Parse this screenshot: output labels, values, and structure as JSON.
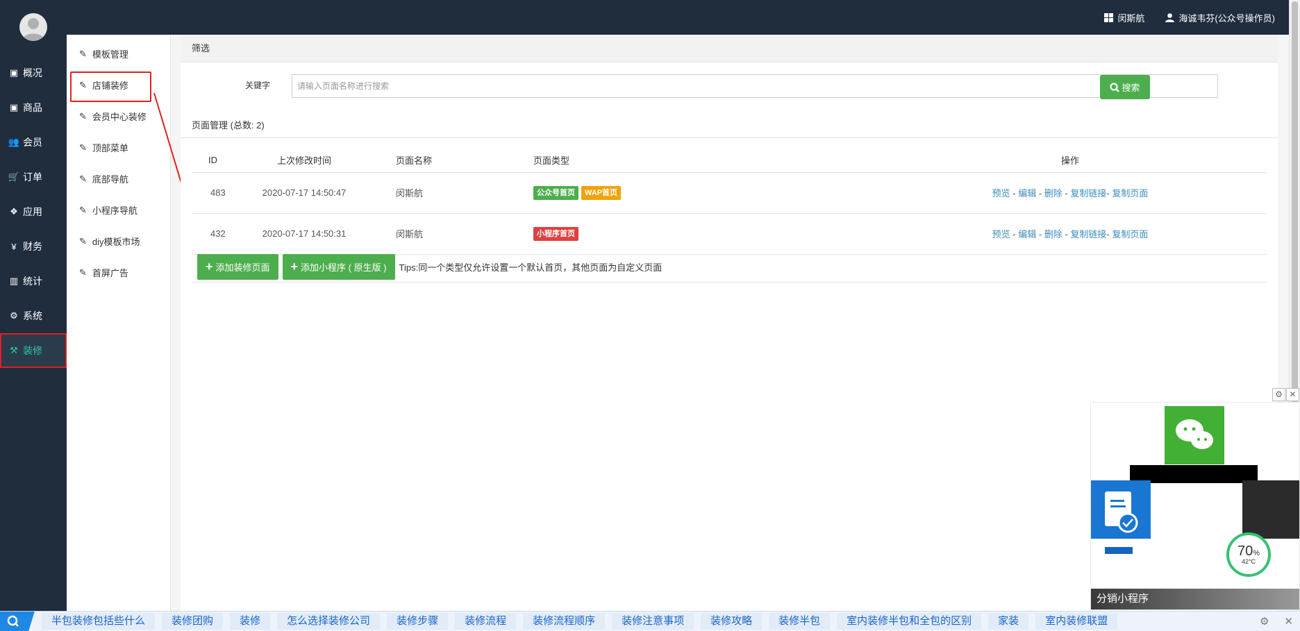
{
  "topbar": {
    "brand_label": "闵斯航",
    "user_label": "海诚韦芬(公众号操作员)"
  },
  "sidebar": {
    "items": [
      {
        "label": "概况",
        "icon": "archive-icon"
      },
      {
        "label": "商品",
        "icon": "archive-icon"
      },
      {
        "label": "会员",
        "icon": "users-icon"
      },
      {
        "label": "订单",
        "icon": "cart-icon"
      },
      {
        "label": "应用",
        "icon": "cubes-icon"
      },
      {
        "label": "财务",
        "icon": "yen-icon"
      },
      {
        "label": "统计",
        "icon": "bar-chart-icon"
      },
      {
        "label": "系统",
        "icon": "gears-icon"
      },
      {
        "label": "装修",
        "icon": "gavel-icon",
        "active": true
      }
    ]
  },
  "subnav": {
    "items": [
      {
        "label": "模板管理"
      },
      {
        "label": "店铺装修",
        "highlight": true
      },
      {
        "label": "会员中心装修"
      },
      {
        "label": "顶部菜单"
      },
      {
        "label": "底部导航"
      },
      {
        "label": "小程序导航"
      },
      {
        "label": "diy模板市场"
      },
      {
        "label": "首屏广告"
      }
    ]
  },
  "filter": {
    "title": "筛选",
    "keyword_label": "关键字",
    "keyword_placeholder": "请输入页面名称进行搜索",
    "search_label": "搜索"
  },
  "page_mgmt": {
    "title": "页面管理 (总数: 2)",
    "columns": [
      "ID",
      "上次修改时间",
      "页面名称",
      "页面类型",
      "操作"
    ],
    "rows": [
      {
        "id": "483",
        "modified": "2020-07-17 14:50:47",
        "name": "闵斯航",
        "tags": [
          {
            "label": "公众号首页",
            "color": "#4cae4c"
          },
          {
            "label": "WAP首页",
            "color": "#f0a30a"
          }
        ]
      },
      {
        "id": "432",
        "modified": "2020-07-17 14:50:31",
        "name": "闵斯航",
        "tags": [
          {
            "label": "小程序首页",
            "color": "#e04040"
          }
        ]
      }
    ],
    "ops": {
      "preview": "预览",
      "edit": "编辑",
      "delete": "删除",
      "copy_link": "复制链接",
      "copy_page": "复制页面"
    },
    "add_page_label": "添加装修页面",
    "add_miniapp_label": "添加小程序 ( 原生版 )",
    "tips": "Tips:同一个类型仅允许设置一个默认首页，其他页面为自定义页面"
  },
  "ad": {
    "caption": "分销小程序",
    "gauge_percent": "70",
    "gauge_percent_unit": "%",
    "gauge_temp": "42°C"
  },
  "bottom_links": [
    "半包装修包括些什么",
    "装修团购",
    "装修",
    "怎么选择装修公司",
    "装修步骤",
    "装修流程",
    "装修流程顺序",
    "装修注意事项",
    "装修攻略",
    "装修半包",
    "室内装修半包和全包的区别",
    "家装",
    "室内装修联盟"
  ],
  "colors": {
    "sidebar_bg": "#1f2d3d",
    "accent_green": "#4cae4c",
    "active_teal": "#2ec7a0",
    "highlight_red": "#e02020",
    "link_blue": "#3c8dbc"
  }
}
